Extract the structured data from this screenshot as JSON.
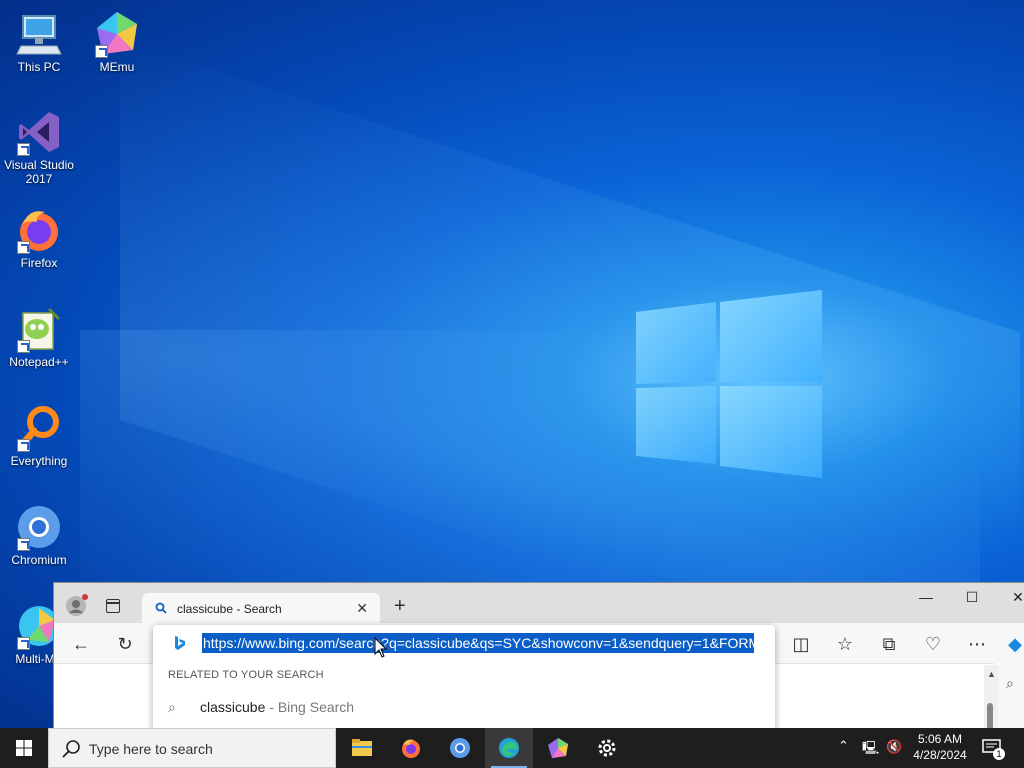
{
  "desktop": {
    "icons": [
      {
        "label": "This PC",
        "icon": "computer-icon"
      },
      {
        "label": "MEmu",
        "icon": "memu-icon"
      },
      {
        "label": "Visual Studio 2017",
        "icon": "visual-studio-icon"
      },
      {
        "label": "Firefox",
        "icon": "firefox-icon"
      },
      {
        "label": "Notepad++",
        "icon": "notepadpp-icon"
      },
      {
        "label": "Everything",
        "icon": "everything-icon"
      },
      {
        "label": "Chromium",
        "icon": "chromium-icon"
      },
      {
        "label": "Multi-ME",
        "icon": "multi-memu-icon"
      }
    ]
  },
  "browser": {
    "tab_title": "classicube - Search",
    "address_url": "https://www.bing.com/search?q=classicube&qs=SYC&showconv=1&sendquery=1&FORM",
    "related_heading": "RELATED TO YOUR SEARCH",
    "suggestion_text": "classicube",
    "suggestion_suffix": " - Bing Search",
    "accent_color": "#0a5ec6"
  },
  "taskbar": {
    "search_placeholder": "Type here to search",
    "pinned": [
      "file-explorer-icon",
      "firefox-icon",
      "chromium-icon",
      "edge-icon",
      "memu-icon",
      "settings-icon"
    ],
    "time": "5:06 AM",
    "date": "4/28/2024",
    "notification_count": "1"
  }
}
